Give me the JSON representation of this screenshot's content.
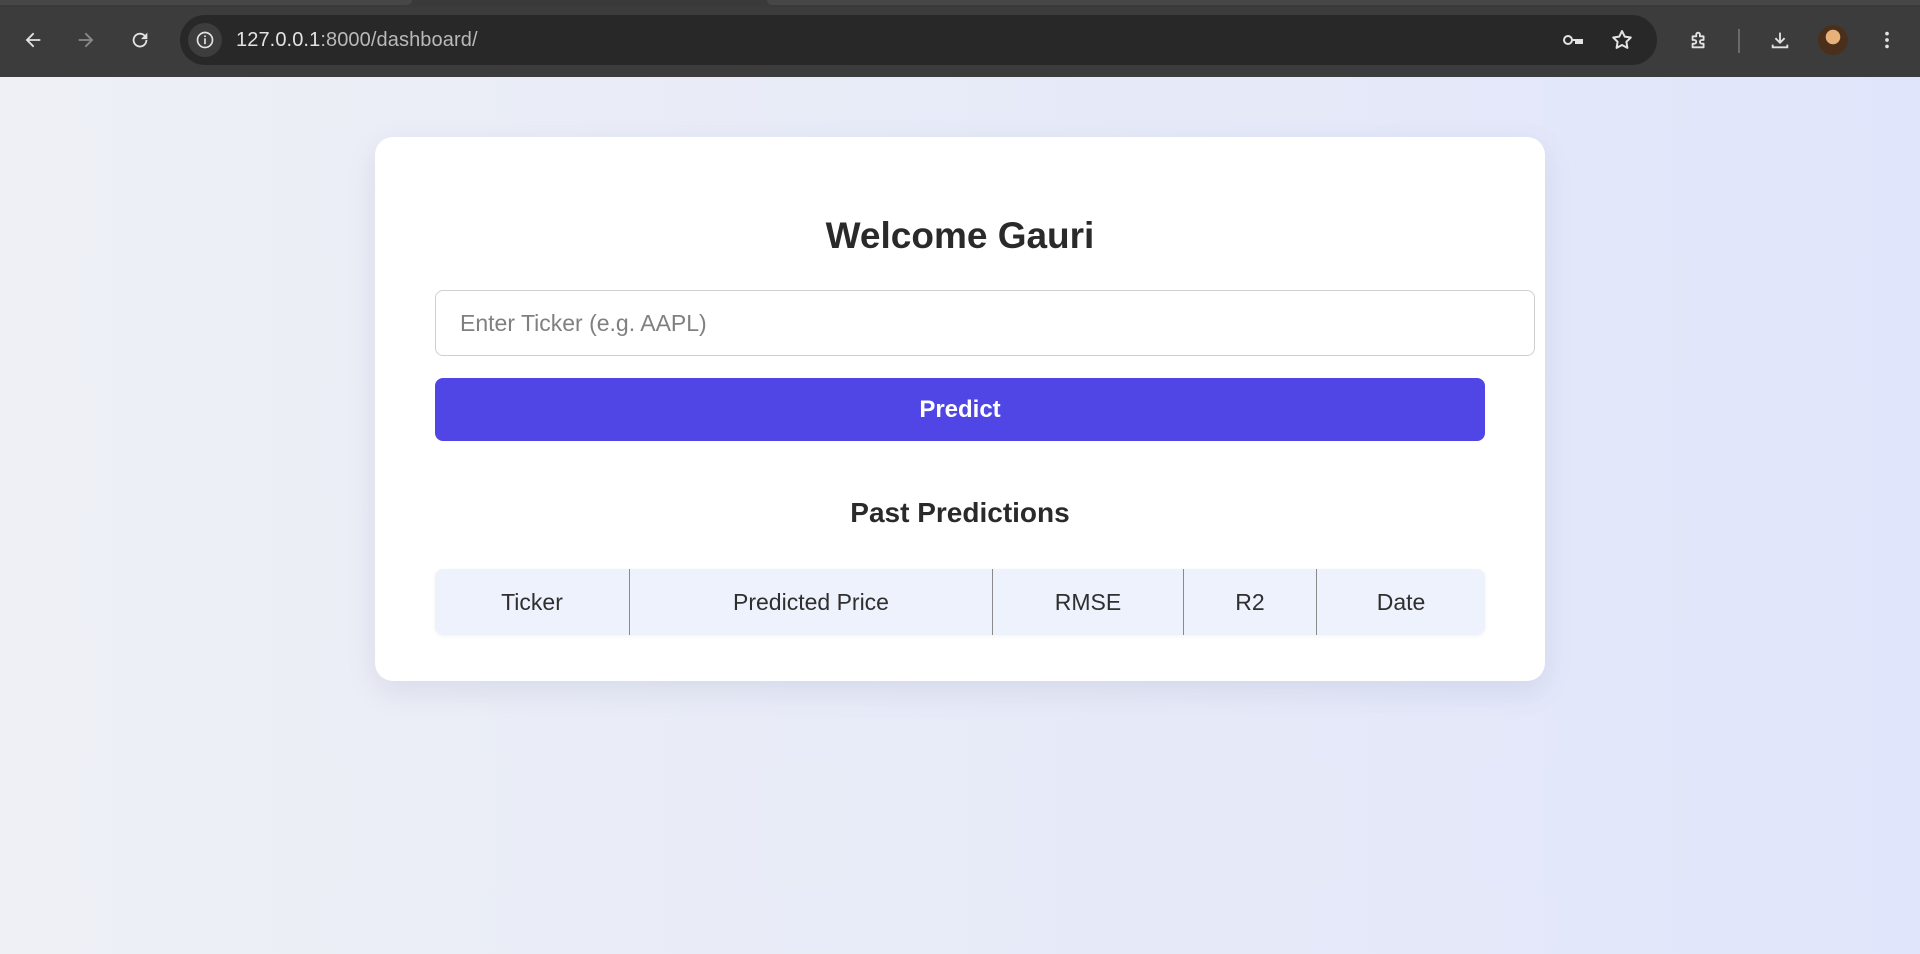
{
  "browser": {
    "url_host": "127.0.0.1",
    "url_path": ":8000/dashboard/",
    "icons": {
      "back": "back-arrow-icon",
      "forward": "forward-arrow-icon",
      "reload": "reload-icon",
      "site_info": "info-icon",
      "password": "key-icon",
      "bookmark": "star-icon",
      "extensions": "puzzle-icon",
      "downloads": "download-icon",
      "menu": "kebab-menu-icon"
    }
  },
  "page": {
    "title": "Welcome Gauri",
    "ticker_placeholder": "Enter Ticker (e.g. AAPL)",
    "ticker_value": "",
    "predict_label": "Predict",
    "past_title": "Past Predictions",
    "table": {
      "columns": [
        "Ticker",
        "Predicted Price",
        "RMSE",
        "R2",
        "Date"
      ],
      "rows": []
    }
  },
  "colors": {
    "accent": "#4f46e5",
    "card": "#ffffff",
    "table_header": "#eef2fd"
  }
}
